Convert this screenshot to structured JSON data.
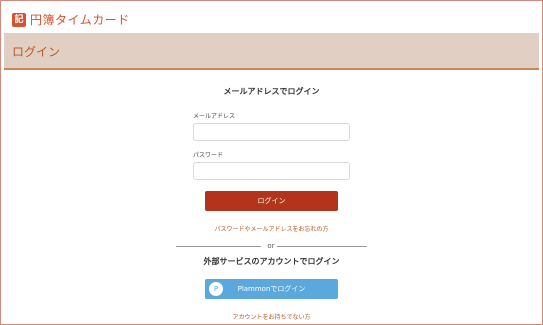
{
  "brand": {
    "icon_text": "記",
    "name": "円簿タイムカード",
    "color": "#d8502e"
  },
  "page_heading": "ログイン",
  "email_login": {
    "title": "メールアドレスでログイン",
    "email_label": "メールアドレス",
    "email_value": "",
    "password_label": "パスワード",
    "password_value": "",
    "submit_label": "ログイン",
    "forgot_link": "パスワードやメールアドレスをお忘れの方"
  },
  "divider_text": "or",
  "external_login": {
    "title": "外部サービスのアカウントでログイン",
    "plammon_icon": "P",
    "plammon_label": "Plammonでログイン"
  },
  "no_account_link": "アカウントをお持ちでない方",
  "colors": {
    "accent": "#b3341a",
    "link": "#c0561f",
    "band": "#e2cfc3",
    "plammon": "#5aa8de"
  }
}
